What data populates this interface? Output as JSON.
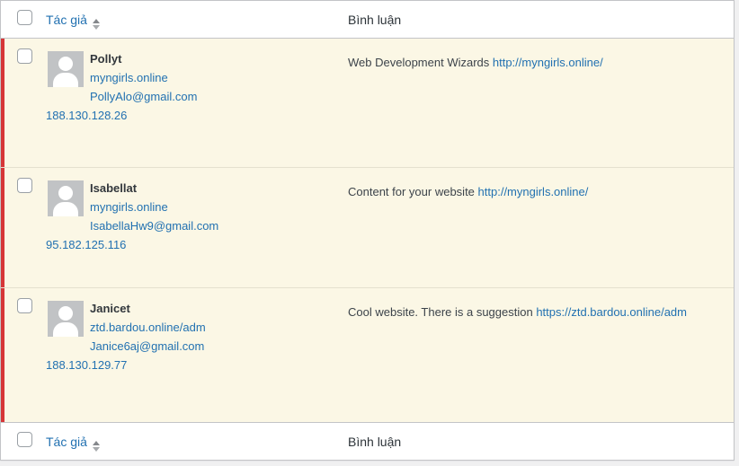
{
  "colors": {
    "unapproved_row_bg": "#fbf7e5",
    "unapproved_border": "#d63638",
    "link_blue": "#2271b1",
    "table_border": "#c3c4c7",
    "page_bg": "#f0f0f1"
  },
  "icons": {
    "sort": "sort-up-down-arrows",
    "avatar": "mystery-person-silhouette"
  },
  "header": {
    "author_label": "Tác giả",
    "comment_label": "Bình luận"
  },
  "footer": {
    "author_label": "Tác giả",
    "comment_label": "Bình luận"
  },
  "table": {
    "rows": [
      {
        "author": "Pollyt",
        "author_url": "myngirls.online",
        "email": "PollyAlo@gmail.com",
        "ip": "188.130.128.26",
        "comment_text": "Web Development Wizards ",
        "comment_link": "http://myngirls.online/"
      },
      {
        "author": "Isabellat",
        "author_url": "myngirls.online",
        "email": "IsabellaHw9@gmail.com",
        "ip": "95.182.125.116",
        "comment_text": "Content for your website ",
        "comment_link": "http://myngirls.online/"
      },
      {
        "author": "Janicet",
        "author_url": "ztd.bardou.online/adm",
        "email": "Janice6aj@gmail.com",
        "ip": "188.130.129.77",
        "comment_text": "Cool website. There is a suggestion ",
        "comment_link": "https://ztd.bardou.online/adm"
      }
    ]
  }
}
